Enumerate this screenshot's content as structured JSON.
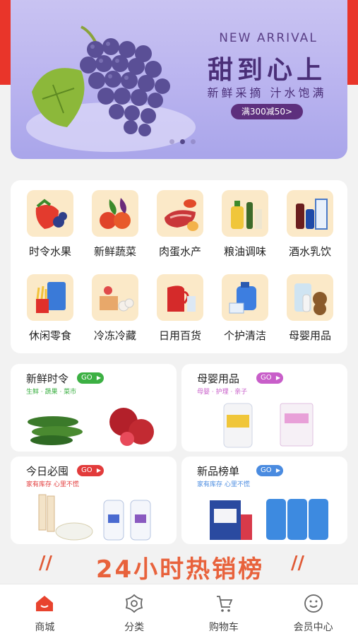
{
  "banner": {
    "headline_en": "NEW ARRIVAL",
    "headline_cn": "甜到心上",
    "tagline": "新鲜采摘 汁水饱满",
    "promo": "满300减50>",
    "slide_count": 3,
    "active_slide": 2
  },
  "categories": [
    {
      "label": "时令水果",
      "icon": "strawberry-icon"
    },
    {
      "label": "新鲜蔬菜",
      "icon": "vegetables-icon"
    },
    {
      "label": "肉蛋水产",
      "icon": "meat-icon"
    },
    {
      "label": "粮油调味",
      "icon": "oil-icon"
    },
    {
      "label": "酒水乳饮",
      "icon": "drinks-icon"
    },
    {
      "label": "休闲零食",
      "icon": "snacks-icon"
    },
    {
      "label": "冷冻冷藏",
      "icon": "frozen-icon"
    },
    {
      "label": "日用百货",
      "icon": "kettle-icon"
    },
    {
      "label": "个护清洁",
      "icon": "detergent-icon"
    },
    {
      "label": "母婴用品",
      "icon": "baby-icon"
    }
  ],
  "promos": [
    {
      "title": "新鲜时令",
      "go": "GO",
      "go_color": "#3cb043",
      "sub": "生鲜 · 蔬果 · 菜市",
      "sub_color": "#3cb043"
    },
    {
      "title": "母婴用品",
      "go": "GO",
      "go_color": "#c85ec9",
      "sub": "母婴 · 护理 · 亲子",
      "sub_color": "#c85ec9"
    },
    {
      "title": "今日必囤",
      "go": "GO",
      "go_color": "#e23b3b",
      "sub": "家有库存  心里不慌",
      "sub_color": "#e23b3b"
    },
    {
      "title": "新品榜单",
      "go": "GO",
      "go_color": "#4a8be0",
      "sub": "家有库存  心里不慌",
      "sub_color": "#4a8be0"
    }
  ],
  "hot_banner": {
    "text": "24小时热销榜",
    "left": "//",
    "right": "//"
  },
  "tabs": [
    {
      "label": "商城",
      "icon": "home-icon",
      "active": true
    },
    {
      "label": "分类",
      "icon": "flower-icon",
      "active": false
    },
    {
      "label": "购物车",
      "icon": "cart-icon",
      "active": false
    },
    {
      "label": "会员中心",
      "icon": "smile-icon",
      "active": false
    }
  ],
  "colors": {
    "accent": "#e9352a",
    "banner_title": "#4a2f78"
  }
}
